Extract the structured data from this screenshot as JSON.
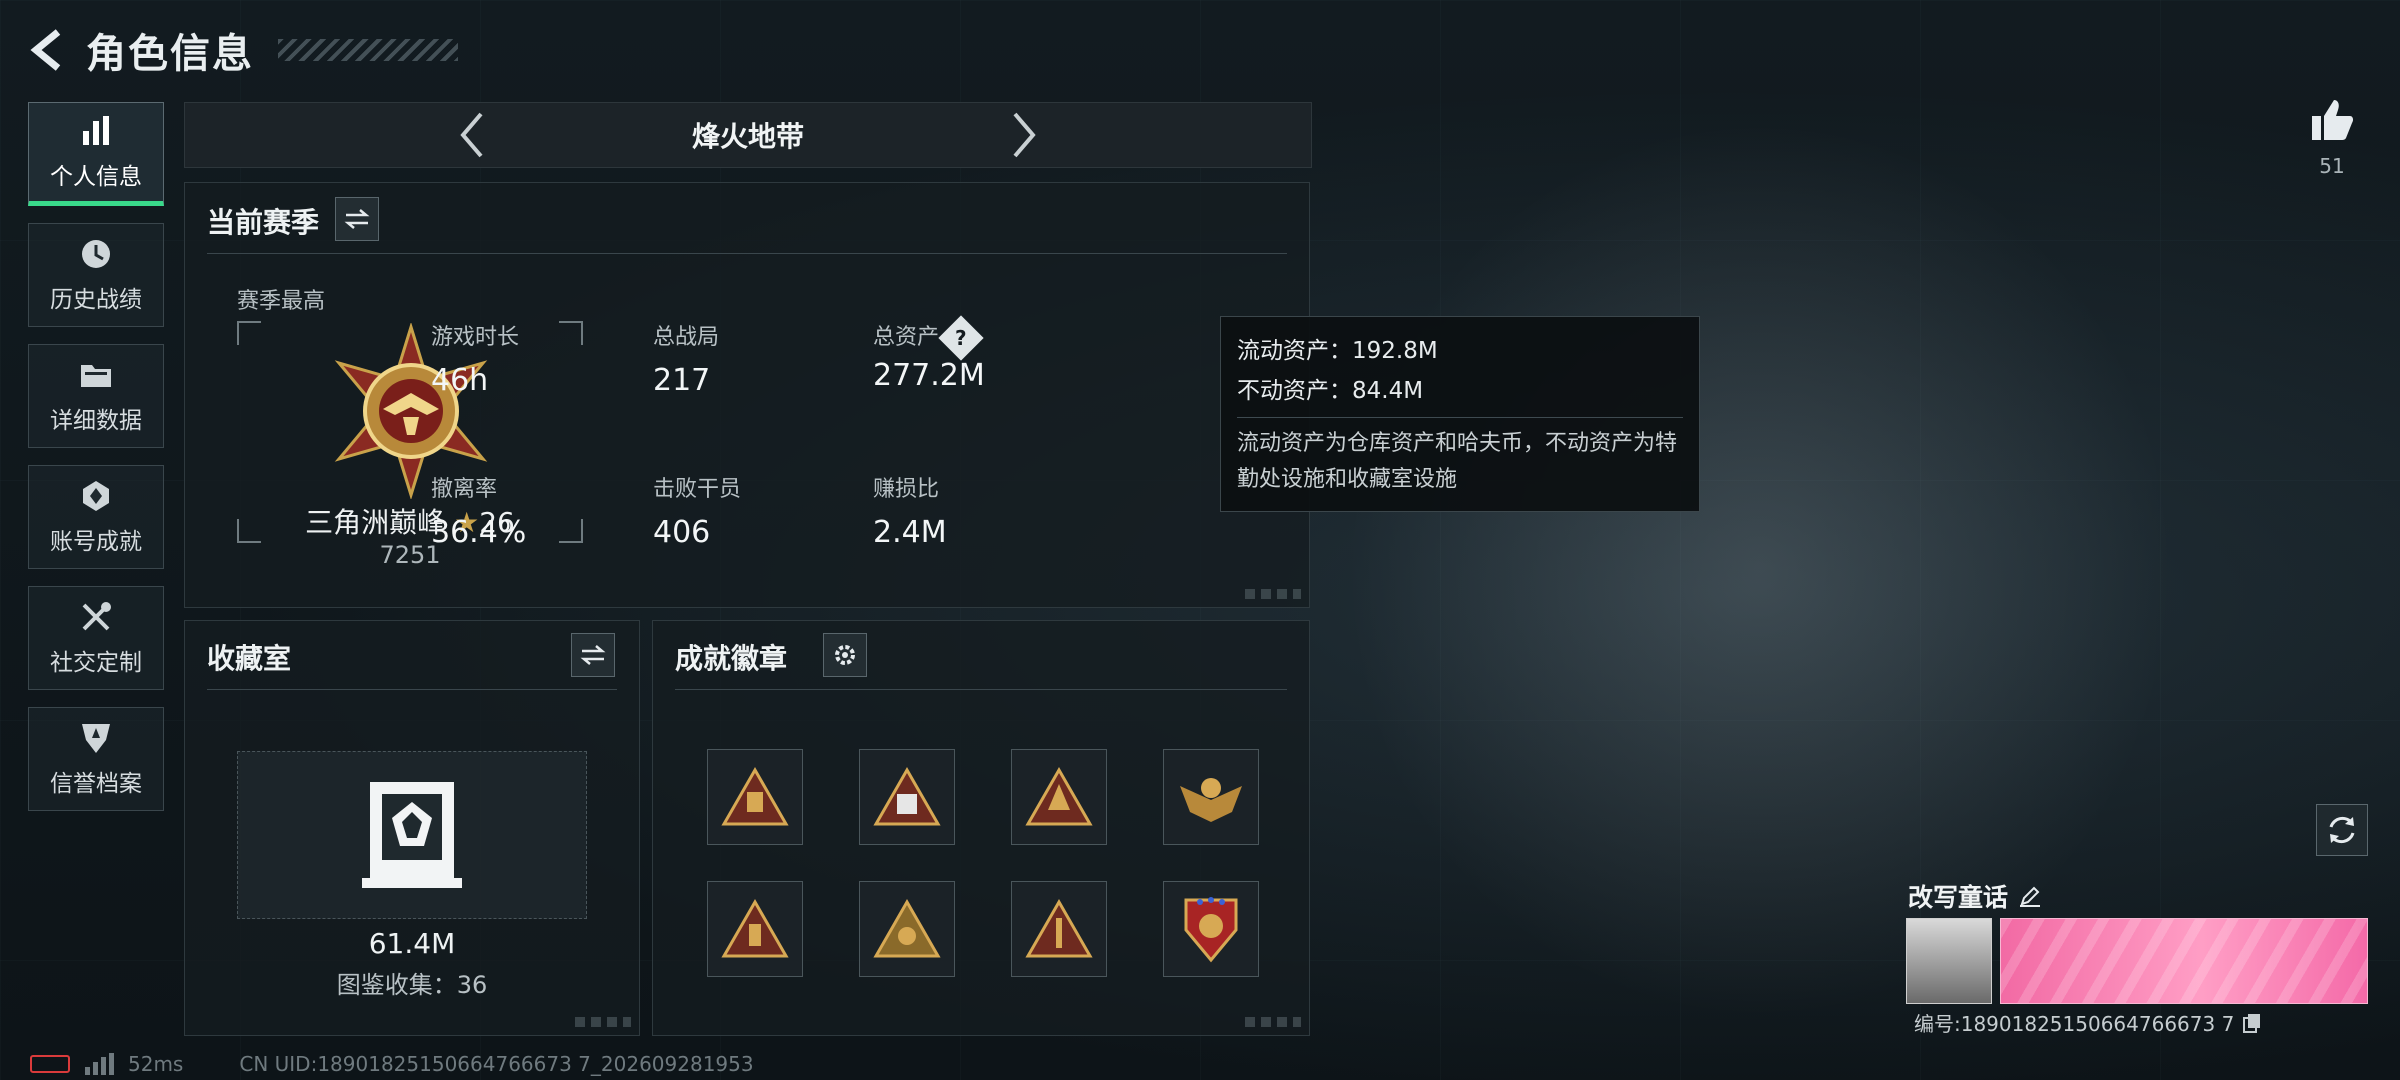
{
  "header": {
    "title": "角色信息"
  },
  "nav": {
    "items": [
      {
        "label": "个人信息",
        "icon": "bar-chart-icon"
      },
      {
        "label": "历史战绩",
        "icon": "clock-icon"
      },
      {
        "label": "详细数据",
        "icon": "folder-icon"
      },
      {
        "label": "账号成就",
        "icon": "achievement-icon"
      },
      {
        "label": "社交定制",
        "icon": "tools-icon"
      },
      {
        "label": "信誉档案",
        "icon": "shield-icon"
      }
    ]
  },
  "mode": {
    "title": "烽火地带"
  },
  "season": {
    "title": "当前赛季",
    "best_label": "赛季最高",
    "rank_name": "三角洲巅峰",
    "rank_stars": "26",
    "rank_score": "7251",
    "stats": [
      {
        "label": "游戏时长",
        "value": "46h"
      },
      {
        "label": "总战局",
        "value": "217"
      },
      {
        "label": "总资产",
        "value": "277.2M"
      },
      {
        "label": "撤离率",
        "value": "36.4%"
      },
      {
        "label": "击败干员",
        "value": "406"
      },
      {
        "label": "赚损比",
        "value": "2.4M"
      }
    ]
  },
  "tooltip": {
    "liquid": "流动资产：192.8M",
    "fixed": "不动资产：84.4M",
    "description": "流动资产为仓库资产和哈夫币，不动资产为特勤处设施和收藏室设施"
  },
  "collection": {
    "title": "收藏室",
    "value": "61.4M",
    "catalog": "图鉴收集：36"
  },
  "achievements": {
    "title": "成就徽章",
    "medals": [
      "medal-1",
      "medal-2",
      "medal-3",
      "medal-4",
      "medal-5",
      "medal-6",
      "medal-7",
      "medal-8"
    ]
  },
  "profile": {
    "likes": "51",
    "card_title": "改写童话",
    "card_id": "编号:18901825150664766673 7"
  },
  "footer": {
    "ping": "52ms",
    "uid": "CN UID:18901825150664766673 7_202609281953"
  },
  "colors": {
    "accent": "#39d98a",
    "panel_bg": "#141c20",
    "gold": "#c9a24a",
    "pink": "#f26aa4"
  }
}
